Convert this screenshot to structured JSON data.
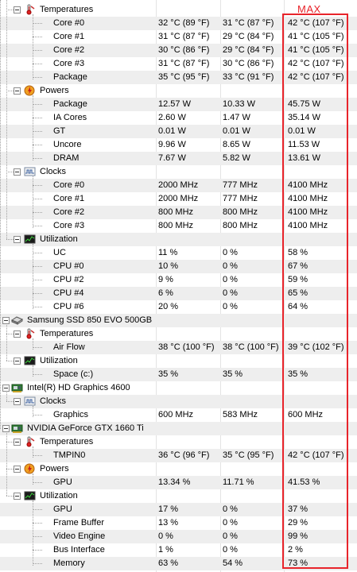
{
  "annotation": {
    "max_label": "MAX",
    "highlight_color": "#e8242b"
  },
  "rows": [
    {
      "level": 1,
      "kind": "group",
      "icon": "thermometer-icon",
      "name": "Temperatures",
      "cut": true
    },
    {
      "level": 2,
      "kind": "item",
      "name": "Core #0",
      "current": "32 °C  (89 °F)",
      "min": "31 °C  (87 °F)",
      "max": "42 °C  (107 °F)"
    },
    {
      "level": 2,
      "kind": "item",
      "name": "Core #1",
      "current": "31 °C  (87 °F)",
      "min": "29 °C  (84 °F)",
      "max": "41 °C  (105 °F)"
    },
    {
      "level": 2,
      "kind": "item",
      "name": "Core #2",
      "current": "30 °C  (86 °F)",
      "min": "29 °C  (84 °F)",
      "max": "41 °C  (105 °F)"
    },
    {
      "level": 2,
      "kind": "item",
      "name": "Core #3",
      "current": "31 °C  (87 °F)",
      "min": "30 °C  (86 °F)",
      "max": "42 °C  (107 °F)"
    },
    {
      "level": 2,
      "kind": "item",
      "name": "Package",
      "current": "35 °C  (95 °F)",
      "min": "33 °C  (91 °F)",
      "max": "42 °C  (107 °F)"
    },
    {
      "level": 1,
      "kind": "group",
      "icon": "power-icon",
      "name": "Powers"
    },
    {
      "level": 2,
      "kind": "item",
      "name": "Package",
      "current": "12.57 W",
      "min": "10.33 W",
      "max": "45.75 W"
    },
    {
      "level": 2,
      "kind": "item",
      "name": "IA Cores",
      "current": "2.60 W",
      "min": "1.47 W",
      "max": "35.14 W"
    },
    {
      "level": 2,
      "kind": "item",
      "name": "GT",
      "current": "0.01 W",
      "min": "0.01 W",
      "max": "0.01 W"
    },
    {
      "level": 2,
      "kind": "item",
      "name": "Uncore",
      "current": "9.96 W",
      "min": "8.65 W",
      "max": "11.53 W"
    },
    {
      "level": 2,
      "kind": "item",
      "name": "DRAM",
      "current": "7.67 W",
      "min": "5.82 W",
      "max": "13.61 W"
    },
    {
      "level": 1,
      "kind": "group",
      "icon": "clock-icon",
      "name": "Clocks"
    },
    {
      "level": 2,
      "kind": "item",
      "name": "Core #0",
      "current": "2000 MHz",
      "min": "777 MHz",
      "max": "4100 MHz"
    },
    {
      "level": 2,
      "kind": "item",
      "name": "Core #1",
      "current": "2000 MHz",
      "min": "777 MHz",
      "max": "4100 MHz"
    },
    {
      "level": 2,
      "kind": "item",
      "name": "Core #2",
      "current": "800 MHz",
      "min": "800 MHz",
      "max": "4100 MHz"
    },
    {
      "level": 2,
      "kind": "item",
      "name": "Core #3",
      "current": "800 MHz",
      "min": "800 MHz",
      "max": "4100 MHz"
    },
    {
      "level": 1,
      "kind": "group",
      "icon": "utilization-icon",
      "name": "Utilization"
    },
    {
      "level": 2,
      "kind": "item",
      "name": "UC",
      "current": "11 %",
      "min": "0 %",
      "max": "58 %"
    },
    {
      "level": 2,
      "kind": "item",
      "name": "CPU #0",
      "current": "10 %",
      "min": "0 %",
      "max": "67 %"
    },
    {
      "level": 2,
      "kind": "item",
      "name": "CPU #2",
      "current": "9 %",
      "min": "0 %",
      "max": "59 %"
    },
    {
      "level": 2,
      "kind": "item",
      "name": "CPU #4",
      "current": "6 %",
      "min": "0 %",
      "max": "65 %"
    },
    {
      "level": 2,
      "kind": "item",
      "name": "CPU #6",
      "current": "20 %",
      "min": "0 %",
      "max": "64 %"
    },
    {
      "level": 0,
      "kind": "device",
      "icon": "ssd-icon",
      "name": "Samsung SSD 850 EVO 500GB"
    },
    {
      "level": 1,
      "kind": "group",
      "icon": "thermometer-icon",
      "name": "Temperatures"
    },
    {
      "level": 2,
      "kind": "item",
      "name": "Air Flow",
      "current": "38 °C  (100 °F)",
      "min": "38 °C  (100 °F)",
      "max": "39 °C  (102 °F)"
    },
    {
      "level": 1,
      "kind": "group",
      "icon": "utilization-icon",
      "name": "Utilization"
    },
    {
      "level": 2,
      "kind": "item",
      "name": "Space (c:)",
      "current": "35 %",
      "min": "35 %",
      "max": "35 %"
    },
    {
      "level": 0,
      "kind": "device",
      "icon": "gpu-card-icon",
      "name": "Intel(R) HD Graphics 4600"
    },
    {
      "level": 1,
      "kind": "group",
      "icon": "clock-icon",
      "name": "Clocks"
    },
    {
      "level": 2,
      "kind": "item",
      "name": "Graphics",
      "current": "600 MHz",
      "min": "583 MHz",
      "max": "600 MHz"
    },
    {
      "level": 0,
      "kind": "device",
      "icon": "gpu-card-icon",
      "name": "NVIDIA GeForce GTX 1660 Ti"
    },
    {
      "level": 1,
      "kind": "group",
      "icon": "thermometer-icon",
      "name": "Temperatures"
    },
    {
      "level": 2,
      "kind": "item",
      "name": "TMPIN0",
      "current": "36 °C  (96 °F)",
      "min": "35 °C  (95 °F)",
      "max": "42 °C  (107 °F)"
    },
    {
      "level": 1,
      "kind": "group",
      "icon": "power-icon",
      "name": "Powers"
    },
    {
      "level": 2,
      "kind": "item",
      "name": "GPU",
      "current": "13.34 %",
      "min": "11.71 %",
      "max": "41.53 %"
    },
    {
      "level": 1,
      "kind": "group",
      "icon": "utilization-icon",
      "name": "Utilization"
    },
    {
      "level": 2,
      "kind": "item",
      "name": "GPU",
      "current": "17 %",
      "min": "0 %",
      "max": "37 %"
    },
    {
      "level": 2,
      "kind": "item",
      "name": "Frame Buffer",
      "current": "13 %",
      "min": "0 %",
      "max": "29 %"
    },
    {
      "level": 2,
      "kind": "item",
      "name": "Video Engine",
      "current": "0 %",
      "min": "0 %",
      "max": "99 %"
    },
    {
      "level": 2,
      "kind": "item",
      "name": "Bus Interface",
      "current": "1 %",
      "min": "0 %",
      "max": "2 %"
    },
    {
      "level": 2,
      "kind": "item",
      "name": "Memory",
      "current": "63 %",
      "min": "54 %",
      "max": "73 %"
    }
  ]
}
